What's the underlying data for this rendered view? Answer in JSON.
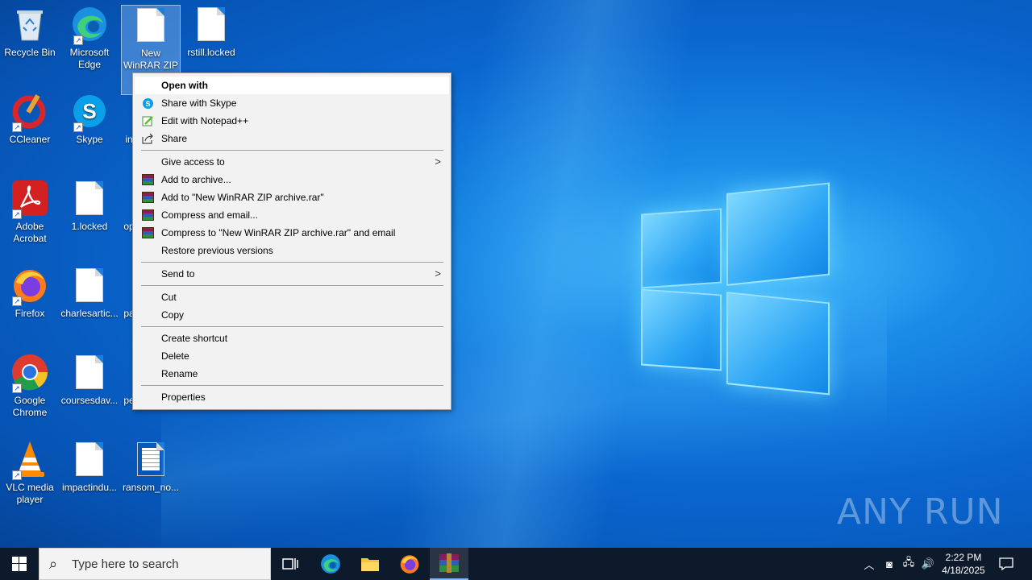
{
  "desktop": {
    "icons": [
      {
        "label": "Recycle Bin"
      },
      {
        "label": "Microsoft Edge"
      },
      {
        "label": "New WinRAR ZIP archive"
      },
      {
        "label": "rstill.locked"
      },
      {
        "label": "CCleaner"
      },
      {
        "label": "Skype"
      },
      {
        "label": "in"
      },
      {
        "label": "Adobe Acrobat"
      },
      {
        "label": "1.locked"
      },
      {
        "label": "op"
      },
      {
        "label": "Firefox"
      },
      {
        "label": "charlesartic..."
      },
      {
        "label": "pa"
      },
      {
        "label": "Google Chrome"
      },
      {
        "label": "coursesdav..."
      },
      {
        "label": "pe"
      },
      {
        "label": "VLC media player"
      },
      {
        "label": "impactindu..."
      },
      {
        "label": "ransom_no..."
      }
    ]
  },
  "context_menu": {
    "items": [
      {
        "label": "Open with",
        "icon": "none"
      },
      {
        "label": "Share with Skype",
        "icon": "skype-icon"
      },
      {
        "label": "Edit with Notepad++",
        "icon": "notepadpp-icon"
      },
      {
        "label": "Share",
        "icon": "share-icon"
      },
      {
        "label": "Give access to",
        "icon": "none"
      },
      {
        "label": "Add to archive...",
        "icon": "winrar-icon"
      },
      {
        "label": "Add to \"New WinRAR ZIP archive.rar\"",
        "icon": "winrar-icon"
      },
      {
        "label": "Compress and email...",
        "icon": "winrar-icon"
      },
      {
        "label": "Compress to \"New WinRAR ZIP archive.rar\" and email",
        "icon": "winrar-icon"
      },
      {
        "label": "Restore previous versions",
        "icon": "none"
      },
      {
        "label": "Send to",
        "icon": "none"
      },
      {
        "label": "Cut",
        "icon": "none"
      },
      {
        "label": "Copy",
        "icon": "none"
      },
      {
        "label": "Create shortcut",
        "icon": "none"
      },
      {
        "label": "Delete",
        "icon": "none"
      },
      {
        "label": "Rename",
        "icon": "none"
      },
      {
        "label": "Properties",
        "icon": "none"
      }
    ]
  },
  "taskbar": {
    "search_placeholder": "Type here to search",
    "time": "2:22 PM",
    "date": "4/18/2025"
  },
  "watermark": "ANY RUN"
}
